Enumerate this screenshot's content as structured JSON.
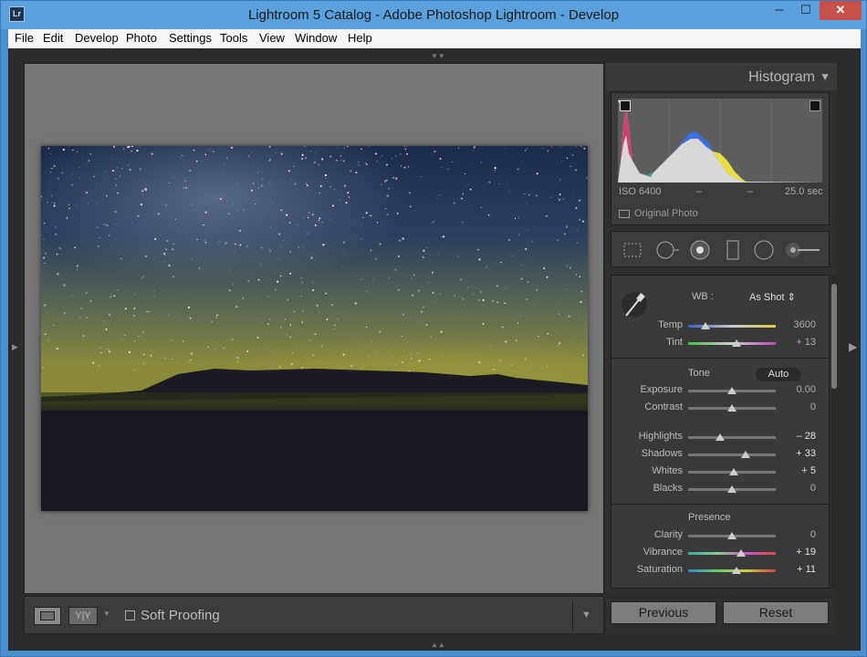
{
  "titlebar": {
    "app_icon": "Lr",
    "title": "Lightroom 5 Catalog - Adobe Photoshop Lightroom - Develop",
    "minimize_icon": "minimize-icon",
    "maximize_icon": "maximize-icon",
    "close_icon": "close-icon"
  },
  "menu": {
    "items": [
      "File",
      "Edit",
      "Develop",
      "Photo",
      "Settings",
      "Tools",
      "View",
      "Window",
      "Help"
    ]
  },
  "photo": {
    "description_icon": "night-sky-photo"
  },
  "toolbar": {
    "compare_label": "Y|Y",
    "soft_proofing": "Soft Proofing"
  },
  "histogram": {
    "title": "Histogram",
    "iso": "ISO 6400",
    "focal": "–",
    "aperture": "–",
    "shutter": "25.0 sec",
    "original_photo": "Original Photo"
  },
  "basic": {
    "wb_label": "WB :",
    "wb_value": "As Shot ⇕",
    "temp": {
      "label": "Temp",
      "value": "3600",
      "pos": 0.2
    },
    "tint": {
      "label": "Tint",
      "value": "+ 13",
      "pos": 0.55
    },
    "tone_title": "Tone",
    "auto_label": "Auto",
    "exposure": {
      "label": "Exposure",
      "value": "0.00",
      "pos": 0.5
    },
    "contrast": {
      "label": "Contrast",
      "value": "0",
      "pos": 0.5
    },
    "highlights": {
      "label": "Highlights",
      "value": "– 28",
      "pos": 0.36
    },
    "shadows": {
      "label": "Shadows",
      "value": "+ 33",
      "pos": 0.66
    },
    "whites": {
      "label": "Whites",
      "value": "+ 5",
      "pos": 0.52
    },
    "blacks": {
      "label": "Blacks",
      "value": "0",
      "pos": 0.5
    },
    "presence_title": "Presence",
    "clarity": {
      "label": "Clarity",
      "value": "0",
      "pos": 0.5
    },
    "vibrance": {
      "label": "Vibrance",
      "value": "+ 19",
      "pos": 0.6
    },
    "saturation": {
      "label": "Saturation",
      "value": "+ 11",
      "pos": 0.55
    }
  },
  "buttons": {
    "previous": "Previous",
    "reset": "Reset"
  }
}
